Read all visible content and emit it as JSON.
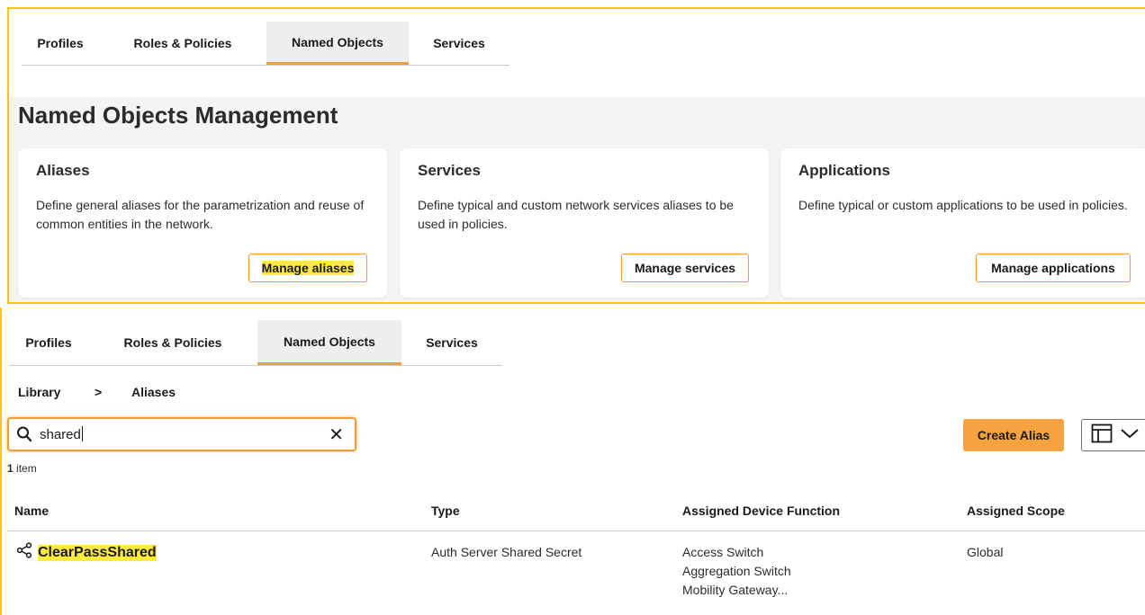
{
  "tabs": [
    "Profiles",
    "Roles & Policies",
    "Named Objects",
    "Services"
  ],
  "active_tab": "Named Objects",
  "page_title": "Named Objects Management",
  "cards": [
    {
      "title": "Aliases",
      "description": "Define general aliases for the parametrization and reuse of common entities in the network.",
      "button": "Manage aliases"
    },
    {
      "title": "Services",
      "description": "Define typical and custom network services aliases to be used in policies.",
      "button": "Manage services"
    },
    {
      "title": "Applications",
      "description": "Define typical or custom applications to be used in policies.",
      "button": "Manage applications"
    }
  ],
  "breadcrumb": {
    "root": "Library",
    "separator": ">",
    "current": "Aliases"
  },
  "search": {
    "value": "shared",
    "clear_icon": "close-icon"
  },
  "actions": {
    "create_label": "Create Alias"
  },
  "results": {
    "count": "1",
    "unit": "item"
  },
  "table": {
    "headers": [
      "Name",
      "Type",
      "Assigned Device Function",
      "Assigned Scope"
    ],
    "rows": [
      {
        "name": "ClearPassShared",
        "type": "Auth Server Shared Secret",
        "functions": [
          "Access Switch",
          "Aggregation Switch",
          "Mobility Gateway..."
        ],
        "scope": "Global"
      }
    ]
  },
  "colors": {
    "accent": "#f29b38",
    "highlight": "#ffeb3b",
    "frame": "#f5c518"
  }
}
